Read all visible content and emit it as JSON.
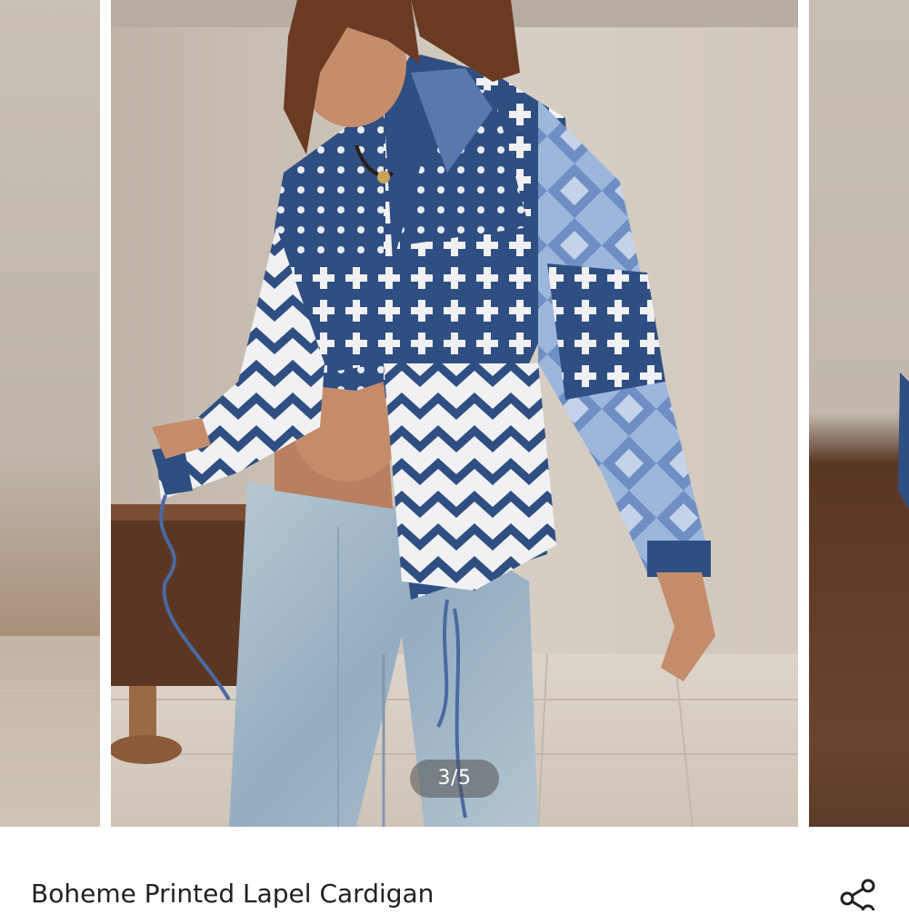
{
  "gallery": {
    "current_index": "3/5",
    "current": 3,
    "total": 5
  },
  "product": {
    "title": "Boheme Printed Lapel Cardigan"
  },
  "icons": {
    "share": "share-icon"
  },
  "colors": {
    "cardigan_navy": "#2f4f82",
    "cardigan_light": "#9db6dc",
    "denim": "#9fb6c8",
    "wall": "#cfc6bc"
  }
}
